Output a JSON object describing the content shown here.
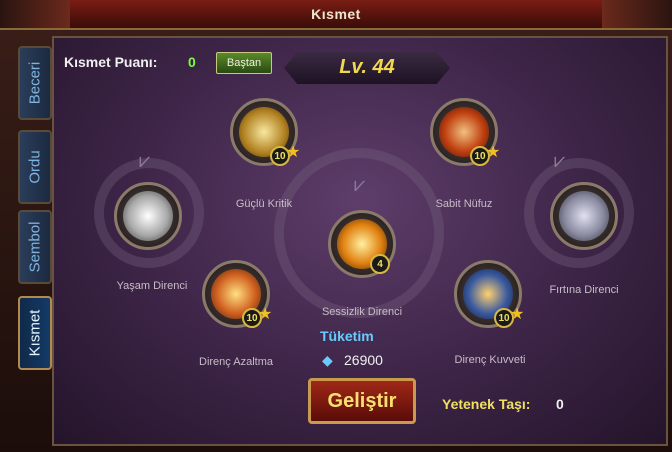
{
  "window": {
    "title": "Kısmet"
  },
  "tabs": [
    {
      "label": "Beceri"
    },
    {
      "label": "Ordu"
    },
    {
      "label": "Sembol"
    },
    {
      "label": "Kısmet"
    }
  ],
  "header": {
    "points_label": "Kısmet Puanı:",
    "points_value": "0",
    "reset_label": "Baştan",
    "level": "Lv. 44"
  },
  "skills": [
    {
      "name": "Güçlü Kritik",
      "level": "10",
      "icon": "claw-icon"
    },
    {
      "name": "Sabit Nüfuz",
      "level": "10",
      "icon": "demon-face-icon"
    },
    {
      "name": "Yaşam Direnci",
      "level": "",
      "icon": "white-swirl-icon"
    },
    {
      "name": "Sessizlik Direnci",
      "level": "4",
      "icon": "golden-fire-icon"
    },
    {
      "name": "Fırtına Direnci",
      "level": "",
      "icon": "lightning-icon"
    },
    {
      "name": "Direnç Azaltma",
      "level": "10",
      "icon": "golden-cross-icon"
    },
    {
      "name": "Direnç Kuvveti",
      "level": "10",
      "icon": "shield-warrior-icon"
    }
  ],
  "cost": {
    "label": "Tüketim",
    "value": "26900",
    "icon": "diamond-icon"
  },
  "upgrade": {
    "label": "Geliştir"
  },
  "stones": {
    "label": "Yetenek Taşı:",
    "value": "0"
  },
  "colors": {
    "accent_gold": "#f0e060",
    "points_green": "#7cff3c",
    "cost_blue": "#66ccff",
    "panel_purple": "#4a2e56"
  }
}
